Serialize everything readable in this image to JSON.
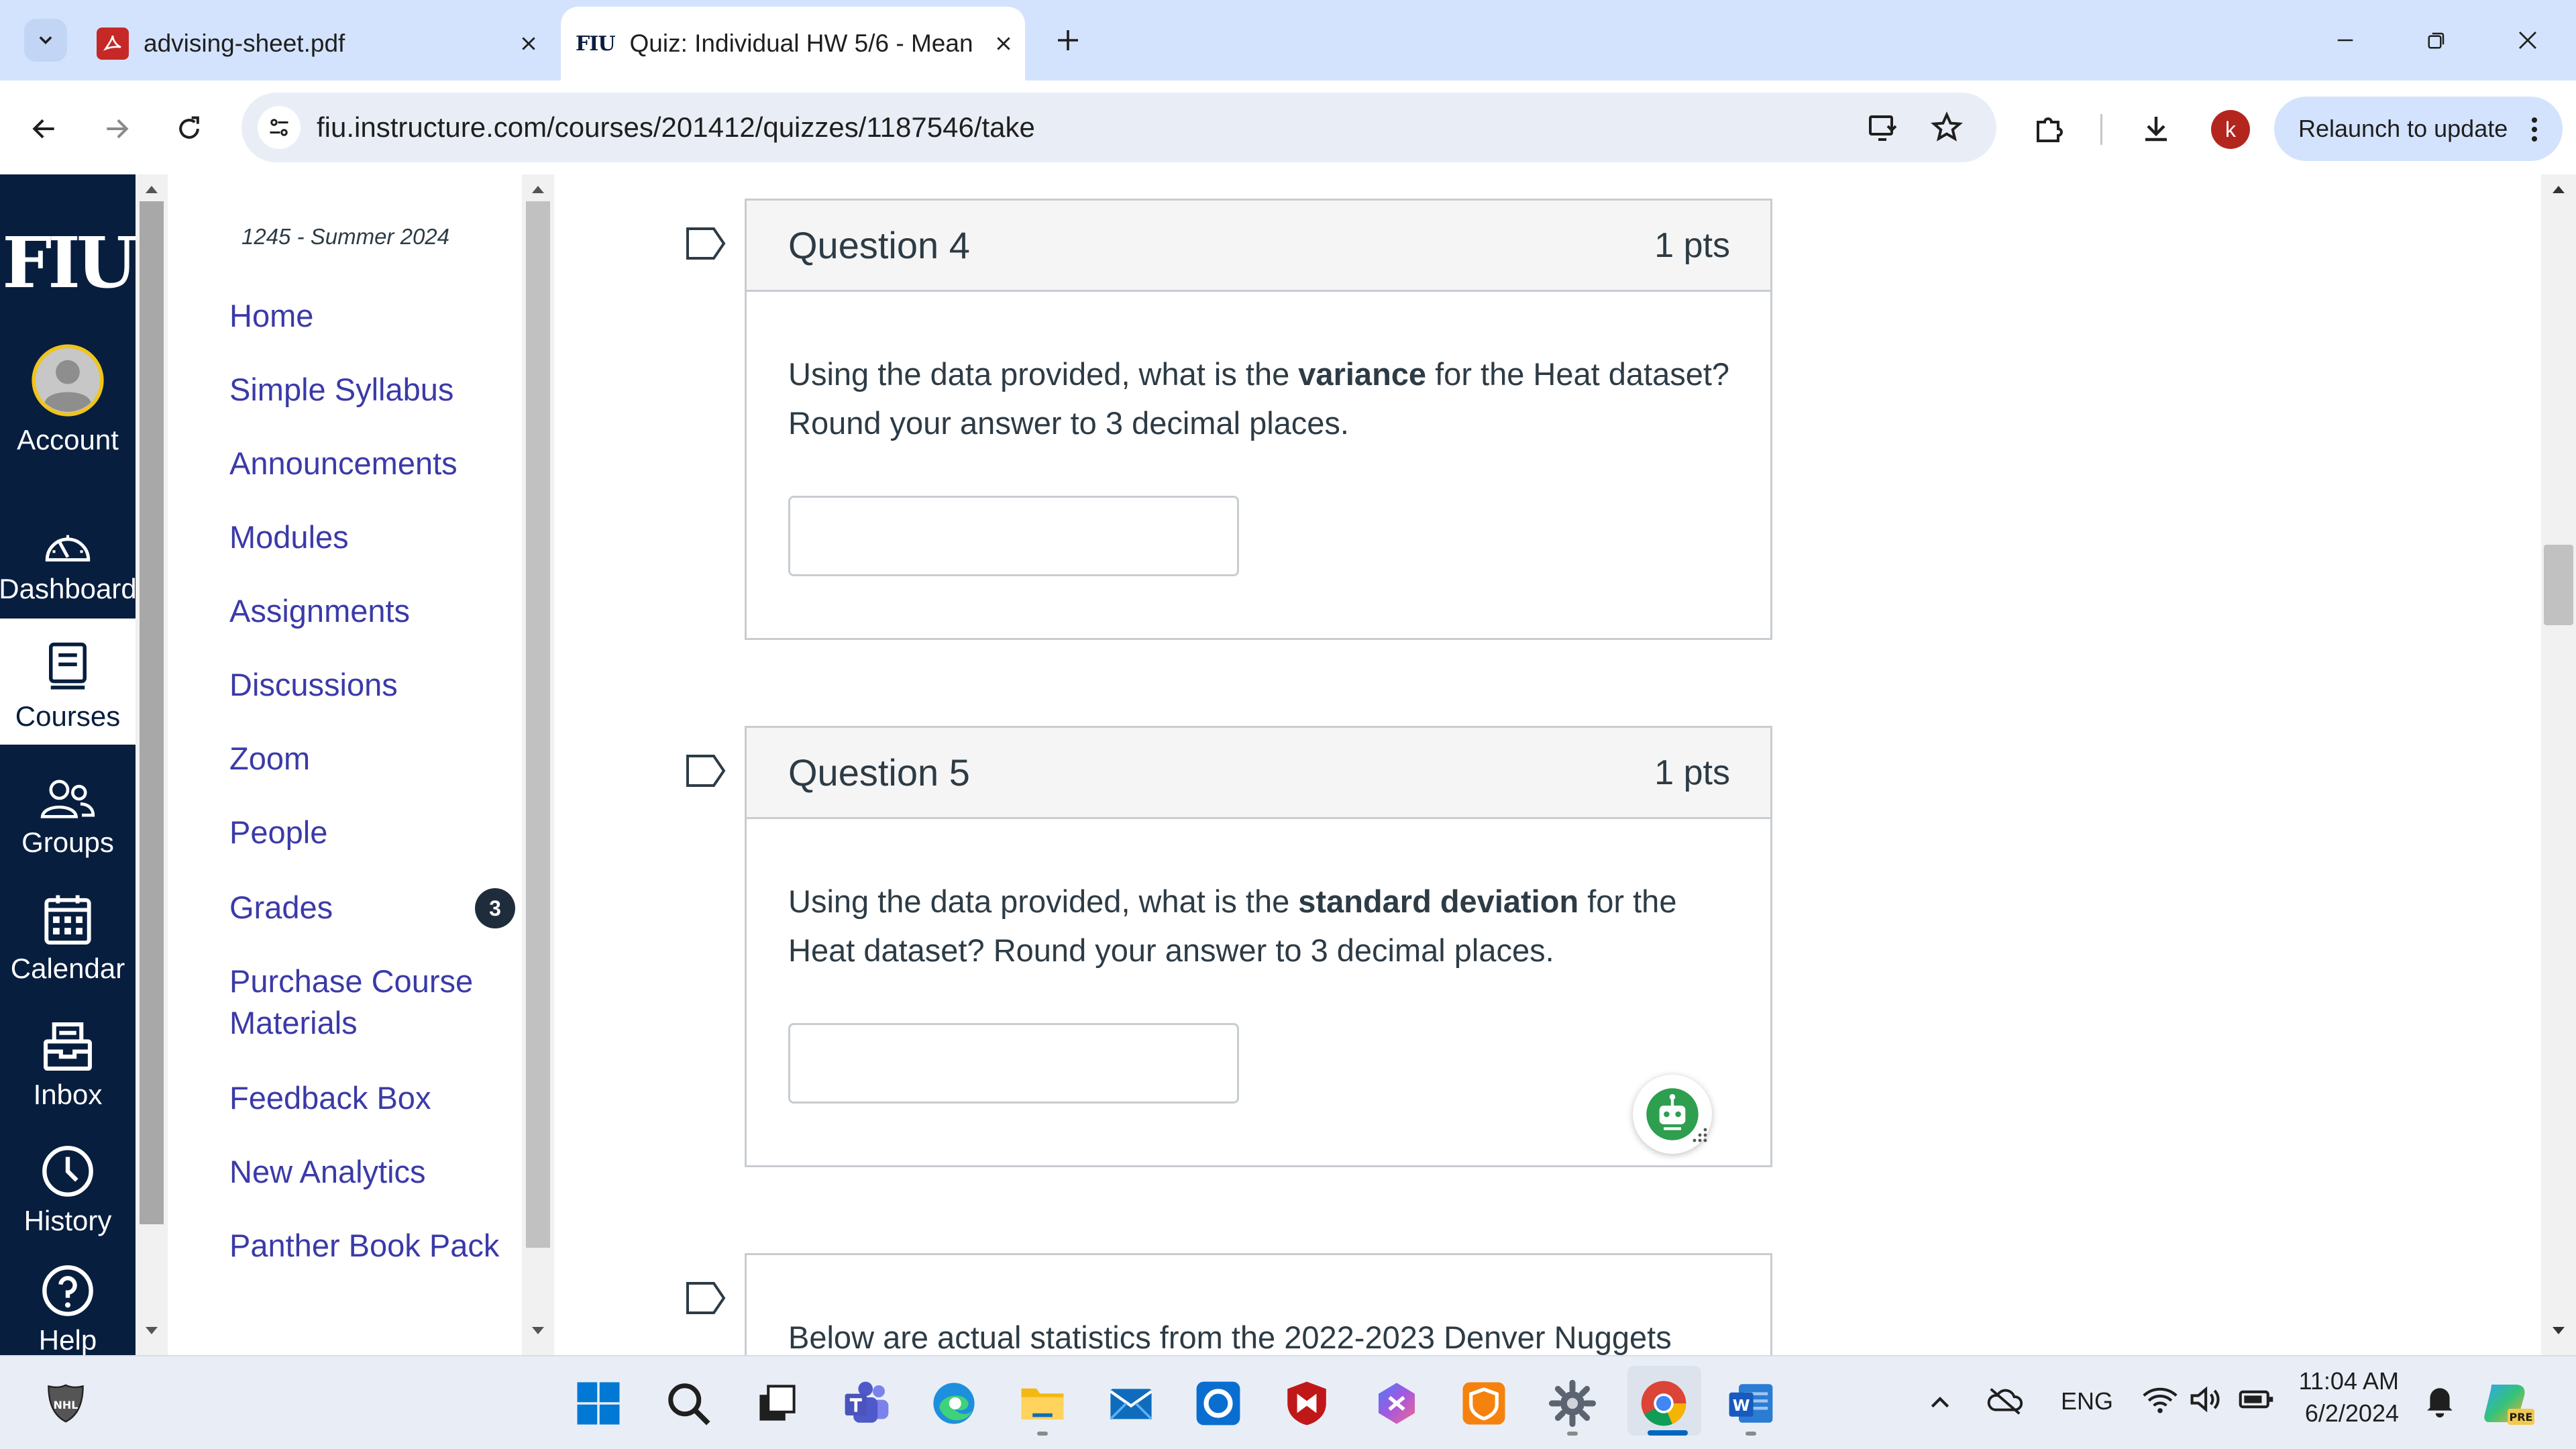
{
  "browser": {
    "tabs": [
      {
        "title": "advising-sheet.pdf",
        "active": false
      },
      {
        "title": "Quiz: Individual HW 5/6 - Mean",
        "favicon_text": "FIU",
        "active": true
      }
    ],
    "url": "fiu.instructure.com/courses/201412/quizzes/1187546/take",
    "profile_initial": "k",
    "relaunch_label": "Relaunch to update"
  },
  "global_nav": {
    "logo": "FIU",
    "items": [
      {
        "label": "Account",
        "icon": "user-avatar-icon"
      },
      {
        "label": "Dashboard",
        "icon": "dashboard-icon"
      },
      {
        "label": "Courses",
        "icon": "courses-icon",
        "active": true
      },
      {
        "label": "Groups",
        "icon": "groups-icon"
      },
      {
        "label": "Calendar",
        "icon": "calendar-icon"
      },
      {
        "label": "Inbox",
        "icon": "inbox-icon"
      },
      {
        "label": "History",
        "icon": "history-icon"
      },
      {
        "label": "Help",
        "icon": "help-icon"
      }
    ]
  },
  "course_nav": {
    "term": "1245 - Summer 2024",
    "links": [
      "Home",
      "Simple Syllabus",
      "Announcements",
      "Modules",
      "Assignments",
      "Discussions",
      "Zoom",
      "People",
      "Grades",
      "Purchase Course Materials",
      "Feedback Box",
      "New Analytics",
      "Panther Book Pack"
    ],
    "grades_badge": "3"
  },
  "quiz": {
    "questions": [
      {
        "title": "Question 4",
        "points": "1 pts",
        "text_before": "Using the data provided, what is the ",
        "text_bold": "variance",
        "text_after": " for the Heat dataset? Round your answer to 3 decimal places.",
        "answer": ""
      },
      {
        "title": "Question 5",
        "points": "1 pts",
        "text_before": "Using the data provided, what is the ",
        "text_bold": "standard deviation",
        "text_after": " for the Heat dataset? Round your answer to 3 decimal places.",
        "answer": ""
      }
    ],
    "next_question_preview": "Below are actual statistics from the 2022-2023 Denver Nuggets"
  },
  "taskbar": {
    "language": "ENG",
    "time": "11:04 AM",
    "date": "6/2/2024"
  }
}
